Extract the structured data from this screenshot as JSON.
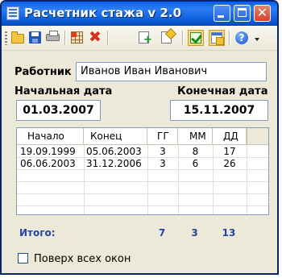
{
  "window": {
    "title": "Расчетник стажа v 2.0",
    "controls": {
      "minimize_icon": "minimize-icon",
      "maximize_icon": "maximize-icon",
      "close_icon": "close-icon",
      "close_glyph": "✕"
    }
  },
  "toolbar": {
    "tools": [
      {
        "name": "open-file",
        "icon": "folder-open-icon"
      },
      {
        "name": "save",
        "icon": "floppy-disk-icon"
      },
      {
        "name": "print",
        "icon": "printer-icon"
      },
      {
        "name": "clear-table",
        "icon": "table-icon"
      },
      {
        "name": "delete",
        "icon": "red-x-icon",
        "glyph": "✖"
      },
      {
        "name": "add-row",
        "icon": "add-document-icon"
      },
      {
        "name": "edit-row",
        "icon": "edit-document-icon"
      },
      {
        "name": "calculate",
        "icon": "check-icon",
        "pressed": true
      },
      {
        "name": "always-on-top",
        "icon": "window-icon",
        "pressed": true
      },
      {
        "name": "help",
        "icon": "help-icon",
        "glyph": "?"
      }
    ],
    "pressed_color": "#fcd77a"
  },
  "form": {
    "employee_label": "Работник",
    "employee_value": "Иванов Иван Иванович",
    "start_date_label": "Начальная дата",
    "start_date_value": "01.03.2007",
    "end_date_label": "Конечная дата",
    "end_date_value": "15.11.2007"
  },
  "table": {
    "columns": [
      "Начало",
      "Конец",
      "ГГ",
      "ММ",
      "ДД"
    ],
    "rows": [
      [
        "19.09.1999",
        "05.06.2003",
        "3",
        "8",
        "17"
      ],
      [
        "06.06.2003",
        "31.12.2006",
        "3",
        "6",
        "26"
      ]
    ]
  },
  "totals": {
    "label": "Итого:",
    "years": "7",
    "months": "3",
    "days": "13",
    "color": "#2446a0"
  },
  "options": {
    "always_on_top_label": "Поверх всех окон",
    "always_on_top_checked": false
  }
}
